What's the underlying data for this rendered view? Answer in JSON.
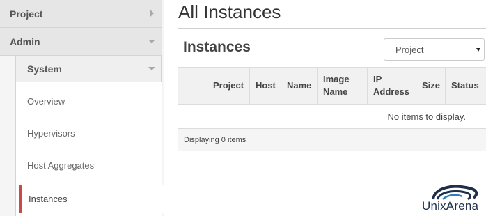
{
  "sidebar": {
    "project": "Project",
    "admin": "Admin",
    "system": "System",
    "items": [
      "Overview",
      "Hypervisors",
      "Host Aggregates"
    ],
    "active_item": "Instances"
  },
  "main": {
    "page_title": "All Instances",
    "section_title": "Instances",
    "filter": {
      "selected": "Project"
    },
    "table": {
      "columns": {
        "project": "Project",
        "host": "Host",
        "name": "Name",
        "image_name_1": "Image",
        "image_name_2": "Name",
        "ip_address_1": "IP",
        "ip_address_2": "Address",
        "size": "Size",
        "status": "Status"
      },
      "empty_message": "No items to display.",
      "footer": "Displaying 0 items"
    }
  },
  "watermark": {
    "text": "UnixArena",
    "color": "#1d2f4a"
  }
}
